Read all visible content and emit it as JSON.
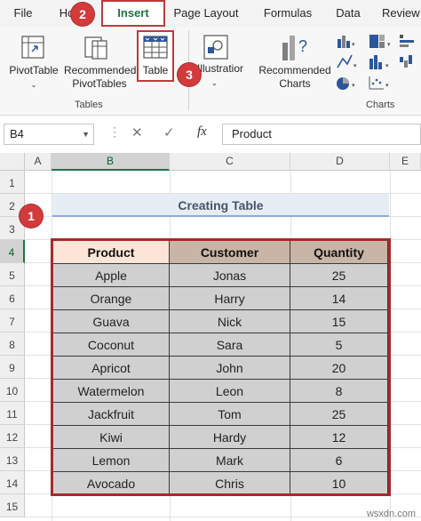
{
  "ribbon_tabs": [
    "File",
    "Ho",
    "Insert",
    "Page Layout",
    "Formulas",
    "Data",
    "Review"
  ],
  "active_tab": "Insert",
  "badges": {
    "one": "1",
    "two": "2",
    "three": "3"
  },
  "ribbon": {
    "pivottable": "PivotTable",
    "recommended_pivot_1": "Recommended",
    "recommended_pivot_2": "PivotTables",
    "table": "Table",
    "illustrations": "Illustrations",
    "recommended_charts_1": "Recommended",
    "recommended_charts_2": "Charts",
    "group_tables": "Tables",
    "group_charts": "Charts"
  },
  "formula_bar": {
    "name_box": "B4",
    "fx": "fx",
    "value": "Product"
  },
  "columns": [
    "A",
    "B",
    "C",
    "D",
    "E"
  ],
  "rows": [
    "1",
    "2",
    "3",
    "4",
    "5",
    "6",
    "7",
    "8",
    "9",
    "10",
    "11",
    "12",
    "13",
    "14",
    "15"
  ],
  "sheet_title": "Creating Table",
  "table": {
    "headers": [
      "Product",
      "Customer",
      "Quantity"
    ],
    "rows": [
      [
        "Apple",
        "Jonas",
        "25"
      ],
      [
        "Orange",
        "Harry",
        "14"
      ],
      [
        "Guava",
        "Nick",
        "15"
      ],
      [
        "Coconut",
        "Sara",
        "5"
      ],
      [
        "Apricot",
        "John",
        "20"
      ],
      [
        "Watermelon",
        "Leon",
        "8"
      ],
      [
        "Jackfruit",
        "Tom",
        "25"
      ],
      [
        "Kiwi",
        "Hardy",
        "12"
      ],
      [
        "Lemon",
        "Mark",
        "6"
      ],
      [
        "Avocado",
        "Chris",
        "10"
      ]
    ]
  },
  "colors": {
    "accent_red": "#d23a3c",
    "excel_green": "#217346",
    "product_header_bg": "#fce4d6",
    "header_bg": "#c9b5a6",
    "body_bg": "#d0d0d0"
  },
  "watermark": "wsxdn.com"
}
